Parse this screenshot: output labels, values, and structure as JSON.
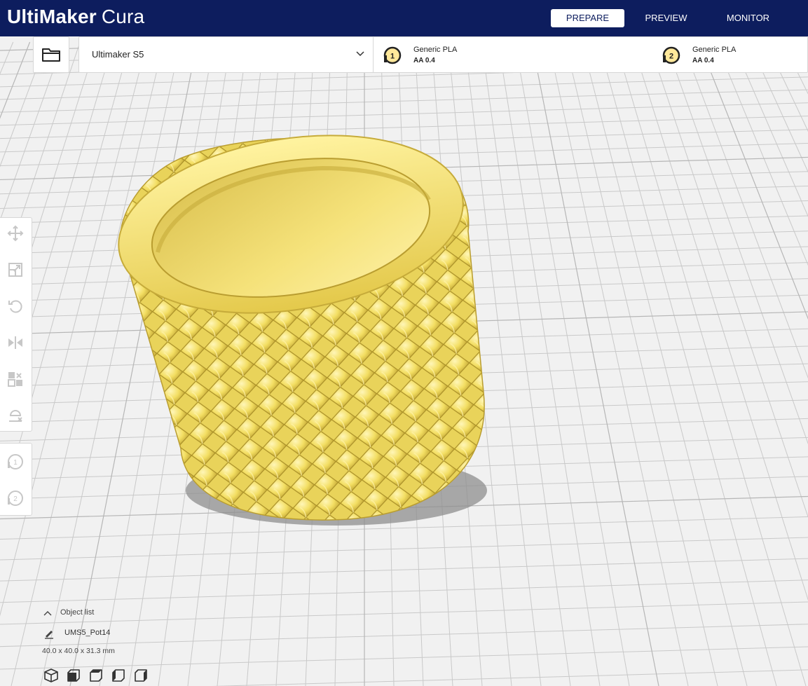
{
  "app": {
    "brand_strong": "UltiMaker",
    "brand_light": "Cura"
  },
  "stages": {
    "prepare": "PREPARE",
    "preview": "PREVIEW",
    "monitor": "MONITOR",
    "active": "prepare"
  },
  "printer": {
    "machine_name": "Ultimaker S5",
    "extruders": [
      {
        "index": "1",
        "material": "Generic PLA",
        "nozzle": "AA 0.4"
      },
      {
        "index": "2",
        "material": "Generic PLA",
        "nozzle": "AA 0.4"
      }
    ]
  },
  "toolbar": {
    "tools": [
      "move-icon",
      "scale-icon",
      "rotate-icon",
      "mirror-icon",
      "per-model-settings-icon",
      "support-blocker-icon"
    ],
    "extruder_buttons": [
      "1",
      "2"
    ]
  },
  "object_panel": {
    "label": "Object list",
    "object_name": "UMS5_Pot14",
    "dimensions": "40.0 x 40.0 x 31.3 mm",
    "view_buttons": [
      "3d-view-icon",
      "front-view-icon",
      "top-view-icon",
      "left-view-icon",
      "right-view-icon"
    ]
  },
  "colors": {
    "header_bg": "#0d1d5e",
    "model_yellow": "#f4e06a",
    "model_shadow": "#c8b043",
    "build_plate": "#f0f0f0",
    "badge_outline": "#222222",
    "badge_fill": "#ffe89a"
  }
}
